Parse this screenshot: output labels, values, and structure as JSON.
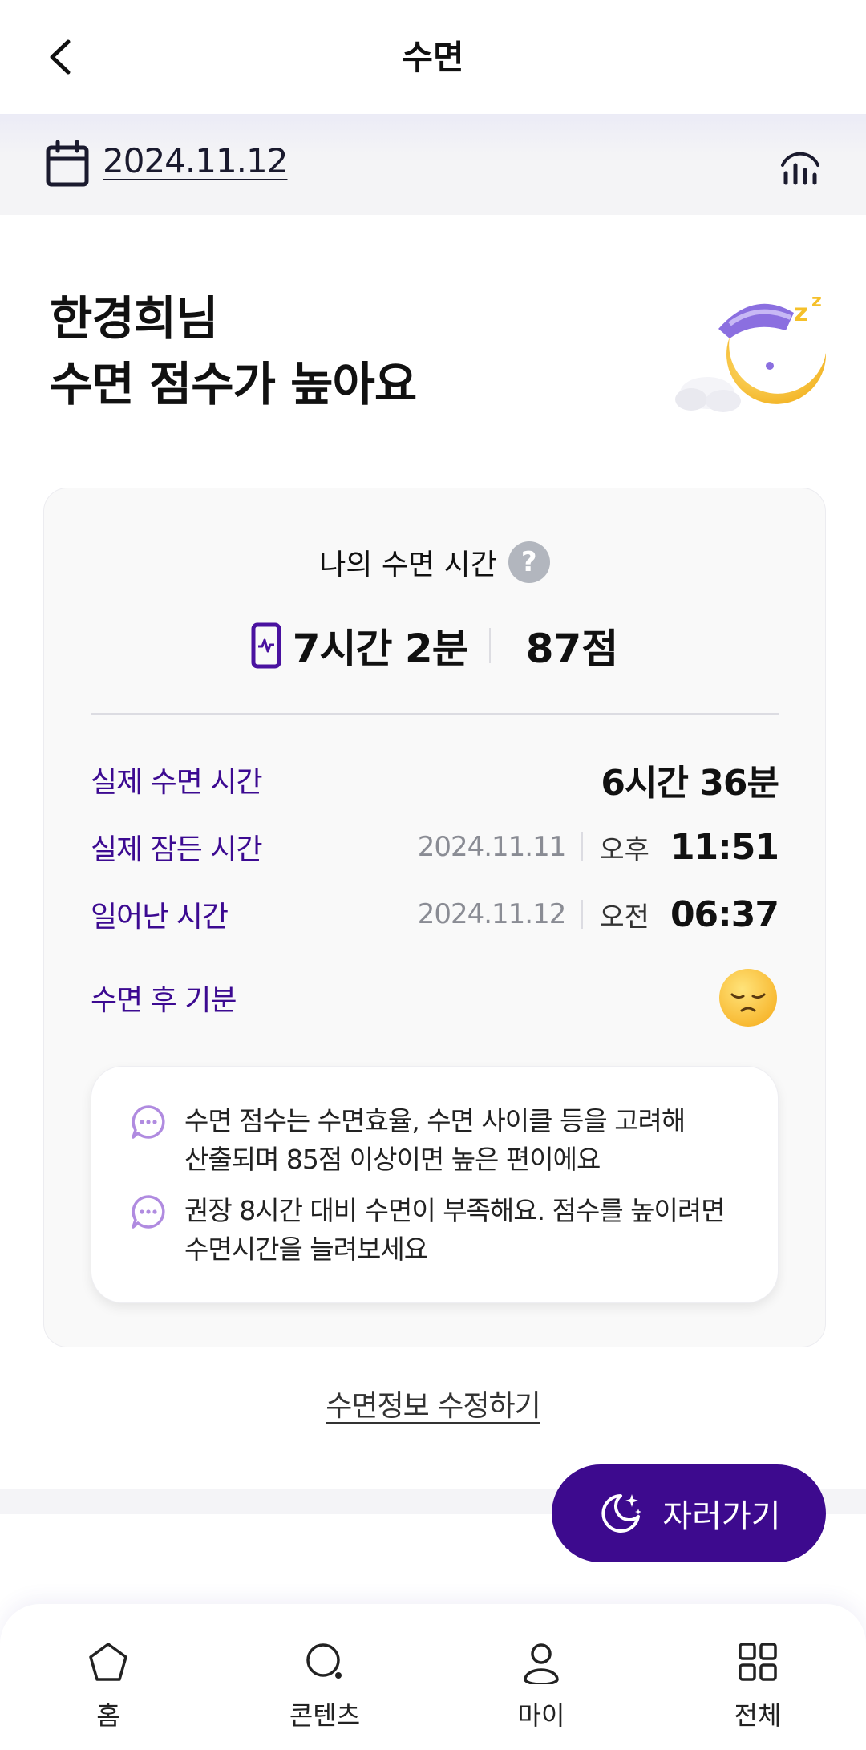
{
  "header": {
    "title": "수면"
  },
  "date_bar": {
    "date": "2024.11.12"
  },
  "greeting": {
    "line1": "한경희님",
    "line2": "수면 점수가 높아요"
  },
  "card": {
    "title": "나의 수면 시간",
    "help_symbol": "?",
    "total_time": "7시간 2분",
    "score": "87점",
    "details": [
      {
        "label": "실제 수면 시간",
        "value": "6시간 36분"
      },
      {
        "label": "실제 잠든 시간",
        "date": "2024.11.11",
        "ampm": "오후",
        "time": "11:51"
      },
      {
        "label": "일어난 시간",
        "date": "2024.11.12",
        "ampm": "오전",
        "time": "06:37"
      },
      {
        "label": "수면 후 기분",
        "mood_icon": "sleepy-face-icon"
      }
    ],
    "tips": [
      {
        "line1": "수면 점수는 수면효율, 수면 사이클 등을 고려해",
        "line2": "산출되며 85점 이상이면 높은 편이에요"
      },
      {
        "line1": "권장 8시간 대비 수면이 부족해요. 점수를 높이려면",
        "line2": "수면시간을 늘려보세요"
      }
    ]
  },
  "edit_link": "수면정보 수정하기",
  "sleep_button": {
    "label": "자러가기",
    "icon": "moon-star-icon"
  },
  "bottom_nav": [
    {
      "label": "홈",
      "icon": "home-icon"
    },
    {
      "label": "콘텐츠",
      "icon": "content-icon"
    },
    {
      "label": "마이",
      "icon": "person-icon"
    },
    {
      "label": "전체",
      "icon": "grid-icon"
    }
  ],
  "colors": {
    "accent": "#3d0a8e",
    "label": "#3c0a91",
    "background_band": "#f4f4f7"
  }
}
